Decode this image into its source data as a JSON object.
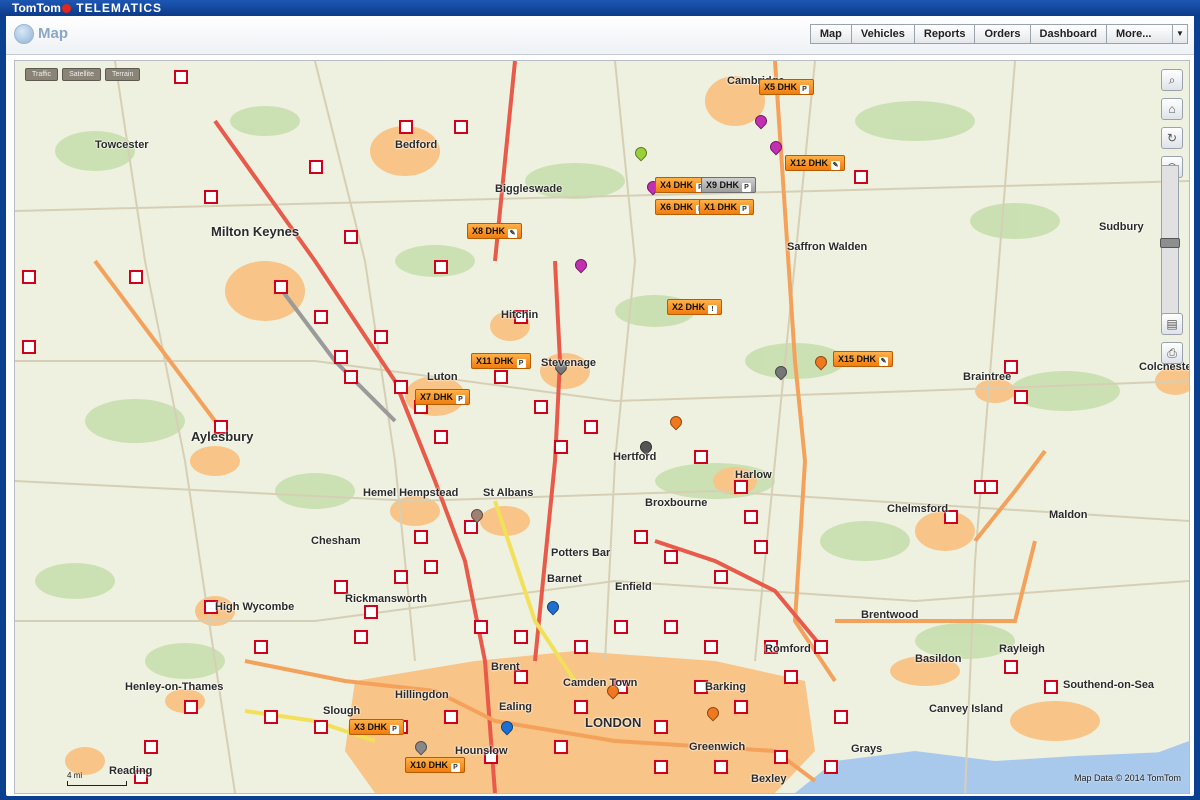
{
  "app": {
    "brand_left": "TomTom",
    "brand_right": "TELEMATICS"
  },
  "header": {
    "title": "Map"
  },
  "nav": [
    {
      "label": "Map"
    },
    {
      "label": "Vehicles"
    },
    {
      "label": "Reports"
    },
    {
      "label": "Orders"
    },
    {
      "label": "Dashboard"
    },
    {
      "label": "More..."
    }
  ],
  "layers": [
    "Traffic",
    "Satellite",
    "Terrain"
  ],
  "vehicles": [
    {
      "label": "X5 DHK",
      "status": "P"
    },
    {
      "label": "X12 DHK",
      "status": "✎"
    },
    {
      "label": "X4 DHK",
      "status": "P"
    },
    {
      "label": "X9 DHK",
      "status": "P"
    },
    {
      "label": "X6 DHK",
      "status": "P"
    },
    {
      "label": "X1 DHK",
      "status": "P"
    },
    {
      "label": "X8 DHK",
      "status": "✎"
    },
    {
      "label": "X2 DHK",
      "status": "!"
    },
    {
      "label": "X15 DHK",
      "status": "✎"
    },
    {
      "label": "X11 DHK",
      "status": "P"
    },
    {
      "label": "X7 DHK",
      "status": "P"
    },
    {
      "label": "X3 DHK",
      "status": "P"
    },
    {
      "label": "X10 DHK",
      "status": "P"
    }
  ],
  "cities": [
    "Towcester",
    "Bedford",
    "Biggleswade",
    "Milton Keynes",
    "Hitchin",
    "Stevenage",
    "Saffron Walden",
    "Sudbury",
    "Luton",
    "Aylesbury",
    "Hertford",
    "Braintree",
    "Colchester",
    "St Albans",
    "Hemel Hempstead",
    "Chelmsford",
    "Maldon",
    "Chesham",
    "Barnet",
    "Enfield",
    "Potters Bar",
    "High Wycombe",
    "Rickmansworth",
    "Brentwood",
    "Basildon",
    "Rayleigh",
    "Southend-on-Sea",
    "Brent",
    "Camden Town",
    "Hillingdon",
    "Henley-on-Thames",
    "Ealing",
    "LONDON",
    "Slough",
    "Barking",
    "Romford",
    "Canvey Island",
    "Grays",
    "Hounslow",
    "Greenwich",
    "Bexley",
    "Reading",
    "Broxbourne",
    "Harlow",
    "Cambridge"
  ],
  "scale_label": "4 mi",
  "credit": "Map Data © 2014 TomTom",
  "colors": {
    "accent": "#0c3b89",
    "vehicle": "#f58a1f",
    "urban": "#f8c487",
    "road": "#e8e3d0"
  }
}
